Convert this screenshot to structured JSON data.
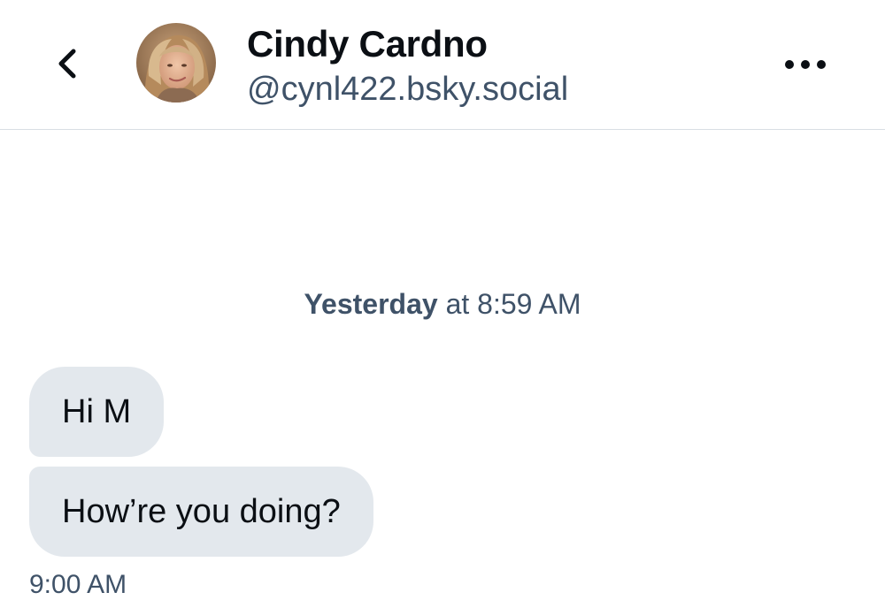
{
  "header": {
    "back_icon": "chevron-left-icon",
    "avatar_alt": "Cindy Cardno avatar",
    "name": "Cindy Cardno",
    "handle": "@cynl422.bsky.social",
    "more_icon": "ellipsis-icon"
  },
  "conversation": {
    "date_separator": {
      "day": "Yesterday",
      "rest": " at 8:59 AM"
    },
    "messages": [
      {
        "text": "Hi M"
      },
      {
        "text": "How’re you doing?"
      }
    ],
    "timestamp": "9:00 AM"
  },
  "colors": {
    "bubble_bg": "#e3e8ed",
    "secondary_text": "#3f5268",
    "primary_text": "#0b0f14",
    "divider": "#d9dee4"
  }
}
